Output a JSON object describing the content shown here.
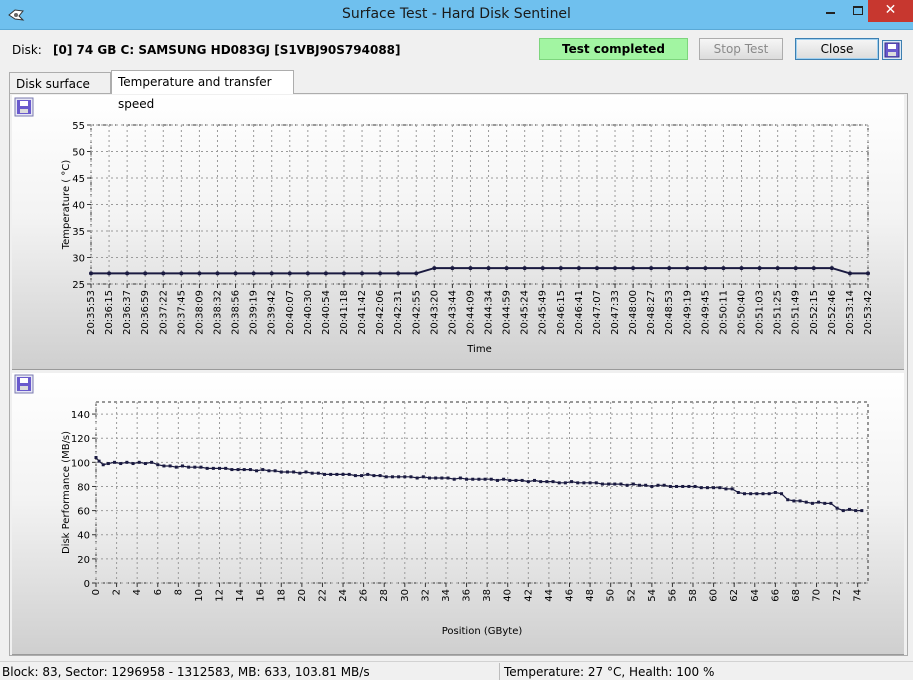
{
  "window": {
    "title": "Surface Test - Hard Disk Sentinel",
    "minimize_glyph": "—",
    "close_glyph": "✕"
  },
  "disk": {
    "label": "Disk:",
    "value": "[0] 74 GB C: SAMSUNG HD083GJ [S1VBJ90S794088]"
  },
  "status": {
    "text": "Test completed",
    "color": "#a2f5a2"
  },
  "buttons": {
    "stop": "Stop Test",
    "close": "Close"
  },
  "tabs": [
    {
      "label": "Disk surface map",
      "active": false
    },
    {
      "label": "Temperature and transfer speed",
      "active": true
    }
  ],
  "statusbar": {
    "block_info": "Block: 83, Sector: 1296958 - 1312583, MB: 633, 103.81 MB/s",
    "temp_health": "Temperature: 27  °C,  Health: 100 %"
  },
  "chart_data": [
    {
      "type": "line",
      "xlabel": "Time",
      "ylabel": "Temperature ( °C)",
      "ylim": [
        25,
        55
      ],
      "yticks": [
        25,
        30,
        35,
        40,
        45,
        50,
        55
      ],
      "grid": true,
      "series_color": "#1a1a40",
      "x": [
        "20:35:53",
        "20:36:15",
        "20:36:37",
        "20:36:59",
        "20:37:22",
        "20:37:45",
        "20:38:09",
        "20:38:32",
        "20:38:56",
        "20:39:19",
        "20:39:42",
        "20:40:07",
        "20:40:30",
        "20:40:54",
        "20:41:18",
        "20:41:42",
        "20:42:06",
        "20:42:31",
        "20:42:55",
        "20:43:20",
        "20:43:44",
        "20:44:09",
        "20:44:34",
        "20:44:59",
        "20:45:24",
        "20:45:49",
        "20:46:15",
        "20:46:41",
        "20:47:07",
        "20:47:33",
        "20:48:00",
        "20:48:27",
        "20:48:53",
        "20:49:19",
        "20:49:45",
        "20:50:11",
        "20:50:40",
        "20:51:03",
        "20:51:25",
        "20:51:49",
        "20:52:15",
        "20:52:46",
        "20:53:14",
        "20:53:42"
      ],
      "values": [
        27,
        27,
        27,
        27,
        27,
        27,
        27,
        27,
        27,
        27,
        27,
        27,
        27,
        27,
        27,
        27,
        27,
        27,
        27,
        28,
        28,
        28,
        28,
        28,
        28,
        28,
        28,
        28,
        28,
        28,
        28,
        28,
        28,
        28,
        28,
        28,
        28,
        28,
        28,
        28,
        28,
        28,
        27,
        27
      ]
    },
    {
      "type": "line",
      "xlabel": "Position (GByte)",
      "ylabel": "Disk Performance (MB/s)",
      "xlim": [
        0,
        75
      ],
      "ylim": [
        0,
        150
      ],
      "xticks": [
        0,
        2,
        4,
        6,
        8,
        10,
        12,
        14,
        16,
        18,
        20,
        22,
        24,
        26,
        28,
        30,
        32,
        34,
        36,
        38,
        40,
        42,
        44,
        46,
        48,
        50,
        52,
        54,
        56,
        58,
        60,
        62,
        64,
        66,
        68,
        70,
        72,
        74
      ],
      "yticks": [
        0,
        20,
        40,
        60,
        80,
        100,
        120,
        140
      ],
      "grid": true,
      "series_color": "#1a1a40",
      "points": [
        [
          0,
          104
        ],
        [
          0.3,
          101
        ],
        [
          0.7,
          98
        ],
        [
          1.2,
          99
        ],
        [
          1.8,
          100
        ],
        [
          2.4,
          99
        ],
        [
          3,
          100
        ],
        [
          3.6,
          99
        ],
        [
          4.2,
          100
        ],
        [
          4.8,
          99
        ],
        [
          5.4,
          100
        ],
        [
          6,
          98
        ],
        [
          6.6,
          97
        ],
        [
          7.2,
          97
        ],
        [
          7.8,
          96
        ],
        [
          8.4,
          97
        ],
        [
          9,
          96
        ],
        [
          9.6,
          96
        ],
        [
          10.2,
          96
        ],
        [
          10.8,
          95
        ],
        [
          11.4,
          95
        ],
        [
          12,
          95
        ],
        [
          12.6,
          95
        ],
        [
          13.2,
          94
        ],
        [
          13.8,
          94
        ],
        [
          14.4,
          94
        ],
        [
          15,
          94
        ],
        [
          15.6,
          93
        ],
        [
          16.2,
          94
        ],
        [
          16.8,
          93
        ],
        [
          17.4,
          93
        ],
        [
          18,
          92
        ],
        [
          18.6,
          92
        ],
        [
          19.2,
          92
        ],
        [
          19.8,
          91
        ],
        [
          20.4,
          92
        ],
        [
          21,
          91
        ],
        [
          21.6,
          91
        ],
        [
          22.2,
          90
        ],
        [
          22.8,
          90
        ],
        [
          23.4,
          90
        ],
        [
          24,
          90
        ],
        [
          24.6,
          90
        ],
        [
          25.2,
          89
        ],
        [
          25.8,
          89
        ],
        [
          26.4,
          90
        ],
        [
          27,
          89
        ],
        [
          27.6,
          89
        ],
        [
          28.2,
          88
        ],
        [
          28.8,
          88
        ],
        [
          29.4,
          88
        ],
        [
          30,
          88
        ],
        [
          30.6,
          88
        ],
        [
          31.2,
          87
        ],
        [
          31.8,
          88
        ],
        [
          32.4,
          87
        ],
        [
          33,
          87
        ],
        [
          33.6,
          87
        ],
        [
          34.2,
          87
        ],
        [
          34.8,
          86
        ],
        [
          35.4,
          87
        ],
        [
          36,
          86
        ],
        [
          36.6,
          86
        ],
        [
          37.2,
          86
        ],
        [
          37.8,
          86
        ],
        [
          38.4,
          86
        ],
        [
          39,
          85
        ],
        [
          39.6,
          86
        ],
        [
          40.2,
          85
        ],
        [
          40.8,
          85
        ],
        [
          41.4,
          85
        ],
        [
          42,
          84
        ],
        [
          42.6,
          85
        ],
        [
          43.2,
          84
        ],
        [
          43.8,
          84
        ],
        [
          44.4,
          84
        ],
        [
          45,
          83
        ],
        [
          45.6,
          83
        ],
        [
          46.2,
          84
        ],
        [
          46.8,
          83
        ],
        [
          47.4,
          83
        ],
        [
          48,
          83
        ],
        [
          48.6,
          83
        ],
        [
          49.2,
          82
        ],
        [
          49.8,
          82
        ],
        [
          50.4,
          82
        ],
        [
          51,
          82
        ],
        [
          51.6,
          81
        ],
        [
          52.2,
          82
        ],
        [
          52.8,
          81
        ],
        [
          53.4,
          81
        ],
        [
          54,
          80
        ],
        [
          54.6,
          81
        ],
        [
          55.2,
          81
        ],
        [
          55.8,
          80
        ],
        [
          56.4,
          80
        ],
        [
          57,
          80
        ],
        [
          57.6,
          80
        ],
        [
          58.2,
          80
        ],
        [
          58.8,
          79
        ],
        [
          59.4,
          79
        ],
        [
          60,
          79
        ],
        [
          60.6,
          79
        ],
        [
          61.2,
          78
        ],
        [
          61.8,
          78
        ],
        [
          62.4,
          75
        ],
        [
          63,
          74
        ],
        [
          63.6,
          74
        ],
        [
          64.2,
          74
        ],
        [
          64.8,
          74
        ],
        [
          65.4,
          74
        ],
        [
          66,
          75
        ],
        [
          66.6,
          74
        ],
        [
          67.2,
          69
        ],
        [
          67.8,
          68
        ],
        [
          68.4,
          68
        ],
        [
          69,
          67
        ],
        [
          69.6,
          66
        ],
        [
          70.2,
          67
        ],
        [
          70.8,
          66
        ],
        [
          71.4,
          66
        ],
        [
          72,
          62
        ],
        [
          72.6,
          60
        ],
        [
          73.2,
          61
        ],
        [
          73.8,
          60
        ],
        [
          74.4,
          60
        ]
      ]
    }
  ]
}
